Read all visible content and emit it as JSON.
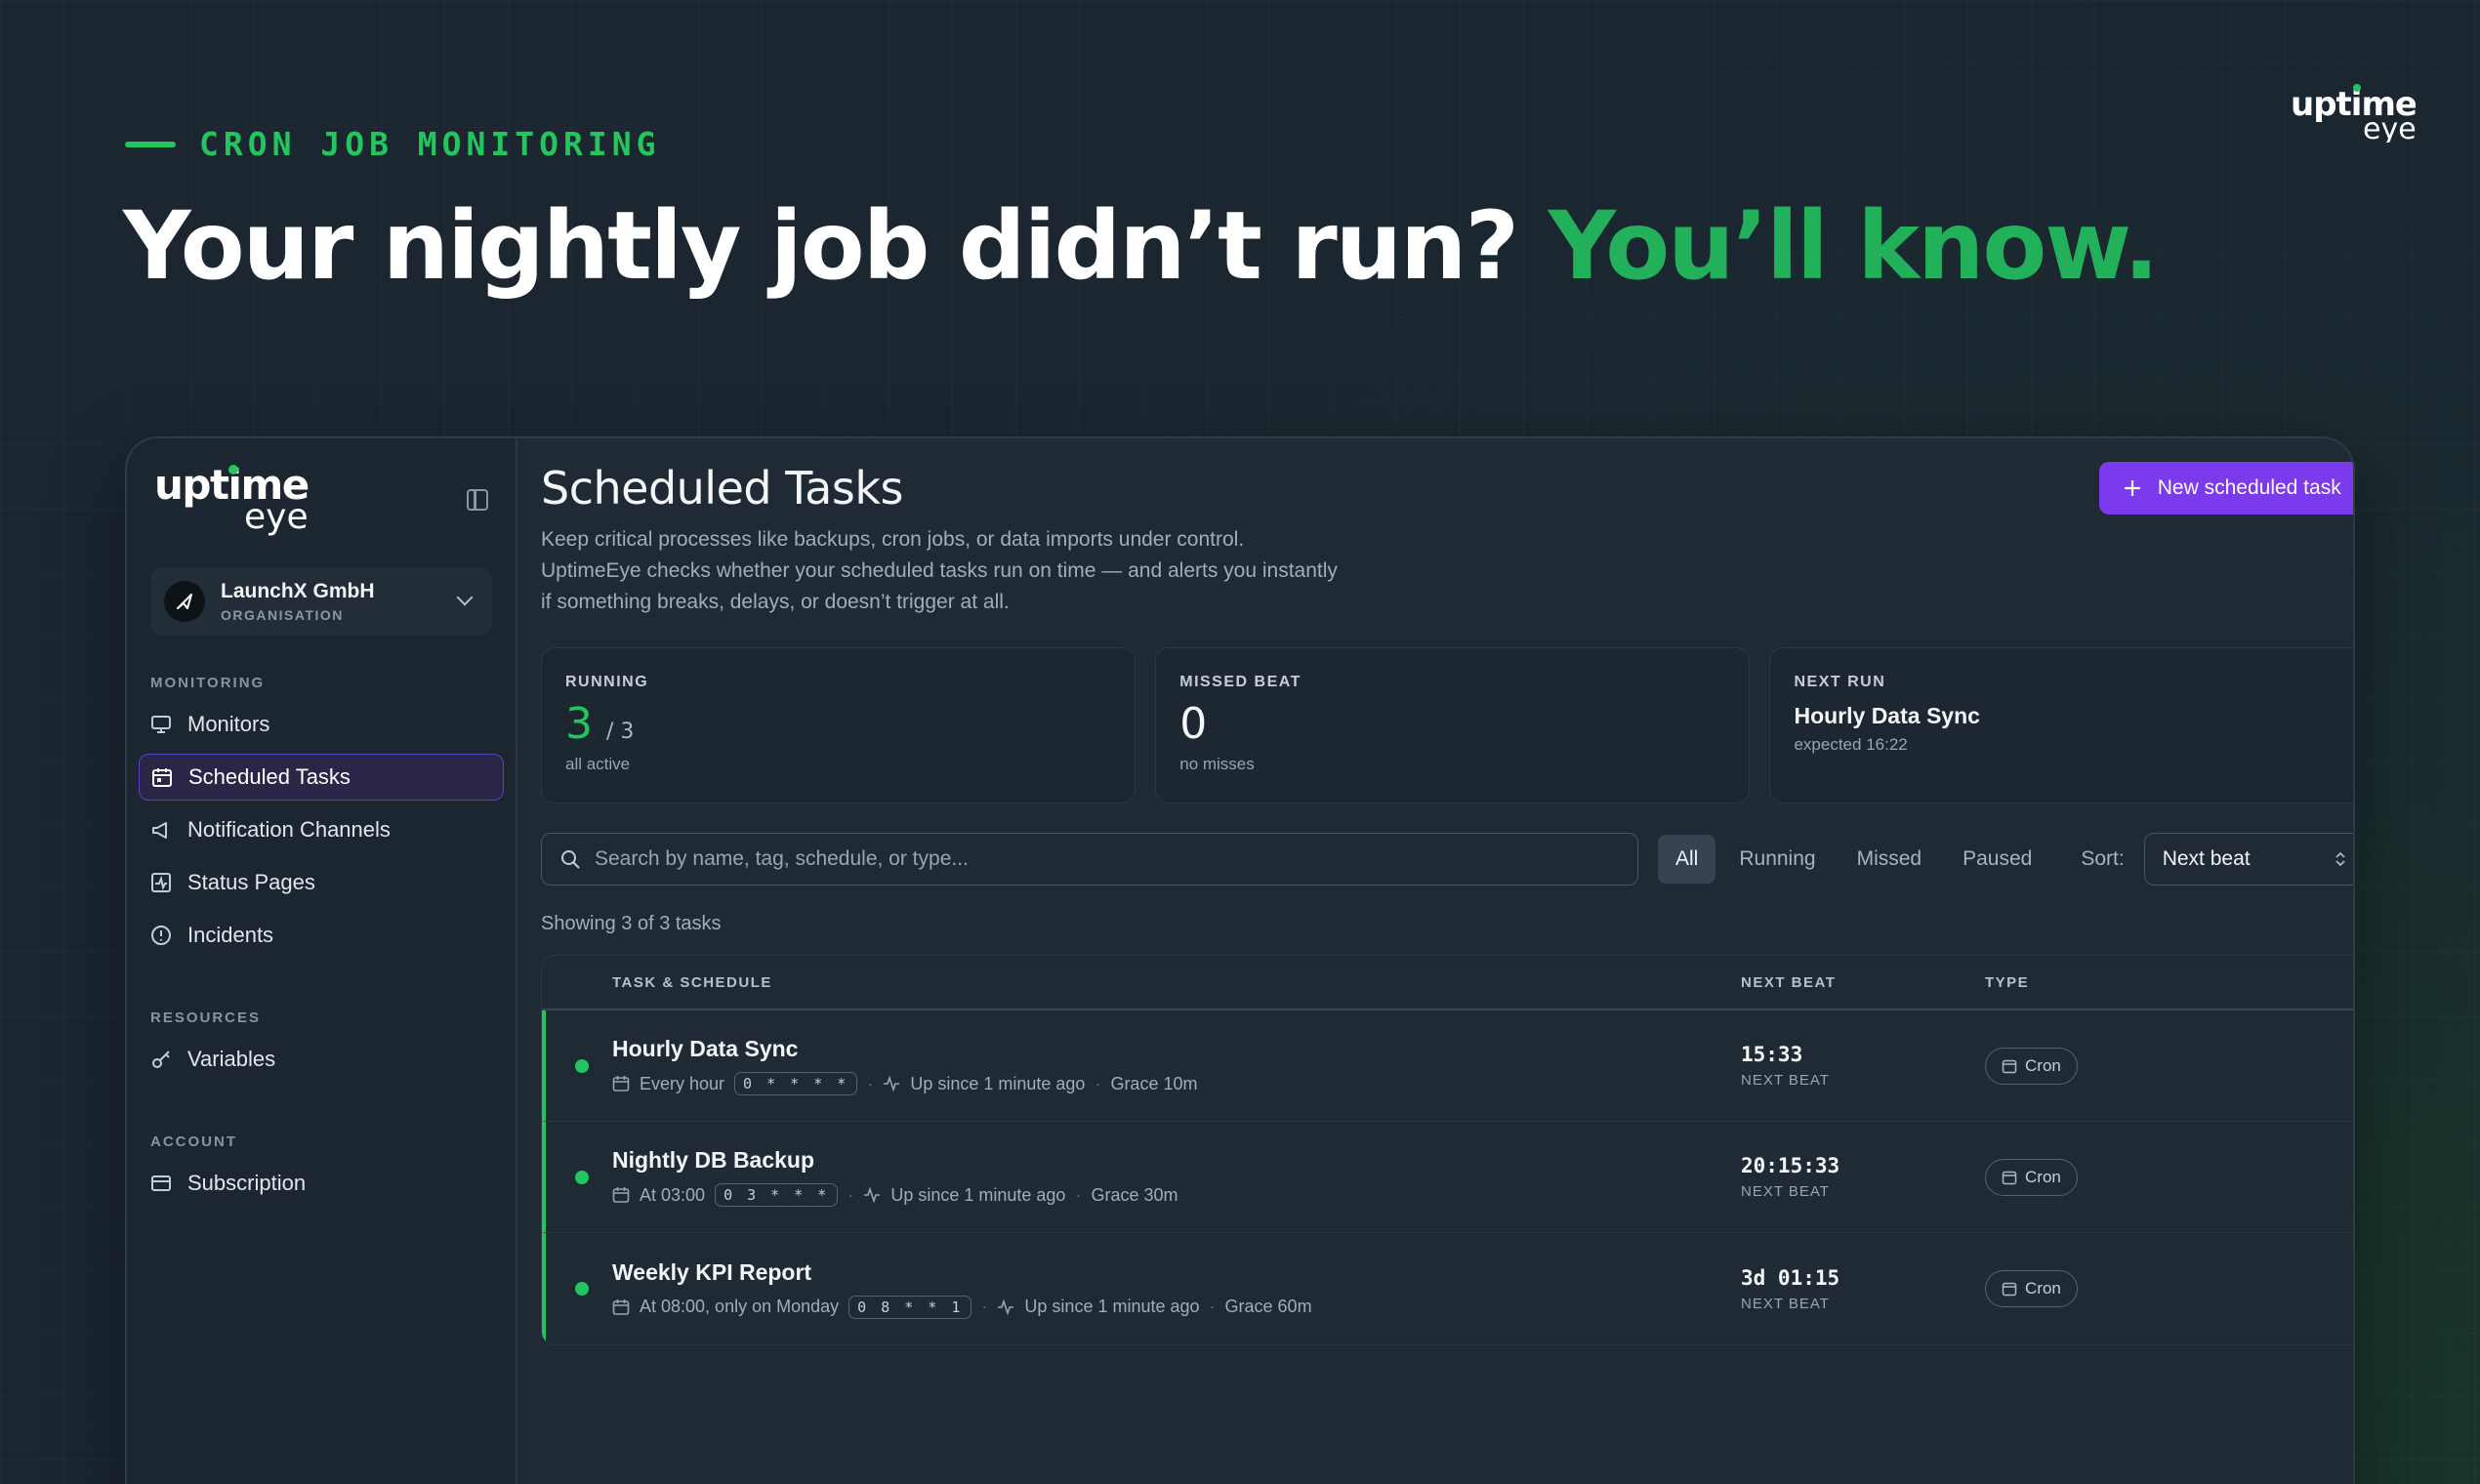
{
  "hero": {
    "eyebrow": "CRON JOB MONITORING",
    "headline_main": "Your nightly job didn’t run? ",
    "headline_accent": "You’ll know.",
    "accent_color": "#22c55e"
  },
  "brand": {
    "logo_top": "uptime",
    "logo_bottom": "eye"
  },
  "sidebar": {
    "org": {
      "name": "LaunchX GmbH",
      "type": "ORGANISATION"
    },
    "sections": [
      {
        "label": "MONITORING",
        "items": [
          {
            "label": "Monitors",
            "icon": "monitor-icon"
          },
          {
            "label": "Scheduled Tasks",
            "icon": "calendar-icon",
            "active": true
          },
          {
            "label": "Notification Channels",
            "icon": "megaphone-icon"
          },
          {
            "label": "Status Pages",
            "icon": "activity-icon"
          },
          {
            "label": "Incidents",
            "icon": "alert-circle-icon"
          }
        ]
      },
      {
        "label": "RESOURCES",
        "items": [
          {
            "label": "Variables",
            "icon": "key-icon"
          }
        ]
      },
      {
        "label": "ACCOUNT",
        "items": [
          {
            "label": "Subscription",
            "icon": "credit-card-icon"
          }
        ]
      }
    ]
  },
  "main": {
    "title": "Scheduled Tasks",
    "description": "Keep critical processes like backups, cron jobs, or data imports under control. UptimeEye checks whether your scheduled tasks run on time — and alerts you instantly if something breaks, delays, or doesn’t trigger at all.",
    "new_button": "New scheduled task",
    "accent_color": "#7c3aed",
    "stats": {
      "running": {
        "label": "RUNNING",
        "value": "3",
        "of": "/ 3",
        "sub": "all active"
      },
      "missed": {
        "label": "MISSED BEAT",
        "value": "0",
        "sub": "no misses"
      },
      "next": {
        "label": "NEXT RUN",
        "title": "Hourly Data Sync",
        "sub": "expected 16:22"
      }
    },
    "search_placeholder": "Search by name, tag, schedule, or type...",
    "filters": [
      "All",
      "Running",
      "Missed",
      "Paused"
    ],
    "active_filter": "All",
    "sort_label": "Sort:",
    "sort_value": "Next beat",
    "count_text": "Showing 3 of 3 tasks",
    "table": {
      "headers": [
        "TASK & SCHEDULE",
        "NEXT BEAT",
        "TYPE"
      ],
      "rows": [
        {
          "name": "Hourly Data Sync",
          "schedule": "Every hour",
          "cron": "0 * * * *",
          "uptime": "Up since 1 minute ago",
          "grace": "Grace 10m",
          "next_beat": "15:33",
          "beat_label": "NEXT BEAT",
          "type": "Cron"
        },
        {
          "name": "Nightly DB Backup",
          "schedule": "At 03:00",
          "cron": "0 3 * * *",
          "uptime": "Up since 1 minute ago",
          "grace": "Grace 30m",
          "next_beat": "20:15:33",
          "beat_label": "NEXT BEAT",
          "type": "Cron"
        },
        {
          "name": "Weekly KPI Report",
          "schedule": "At 08:00, only on Monday",
          "cron": "0 8 * * 1",
          "uptime": "Up since 1 minute ago",
          "grace": "Grace 60m",
          "next_beat": "3d 01:15",
          "beat_label": "NEXT BEAT",
          "type": "Cron"
        }
      ]
    }
  }
}
